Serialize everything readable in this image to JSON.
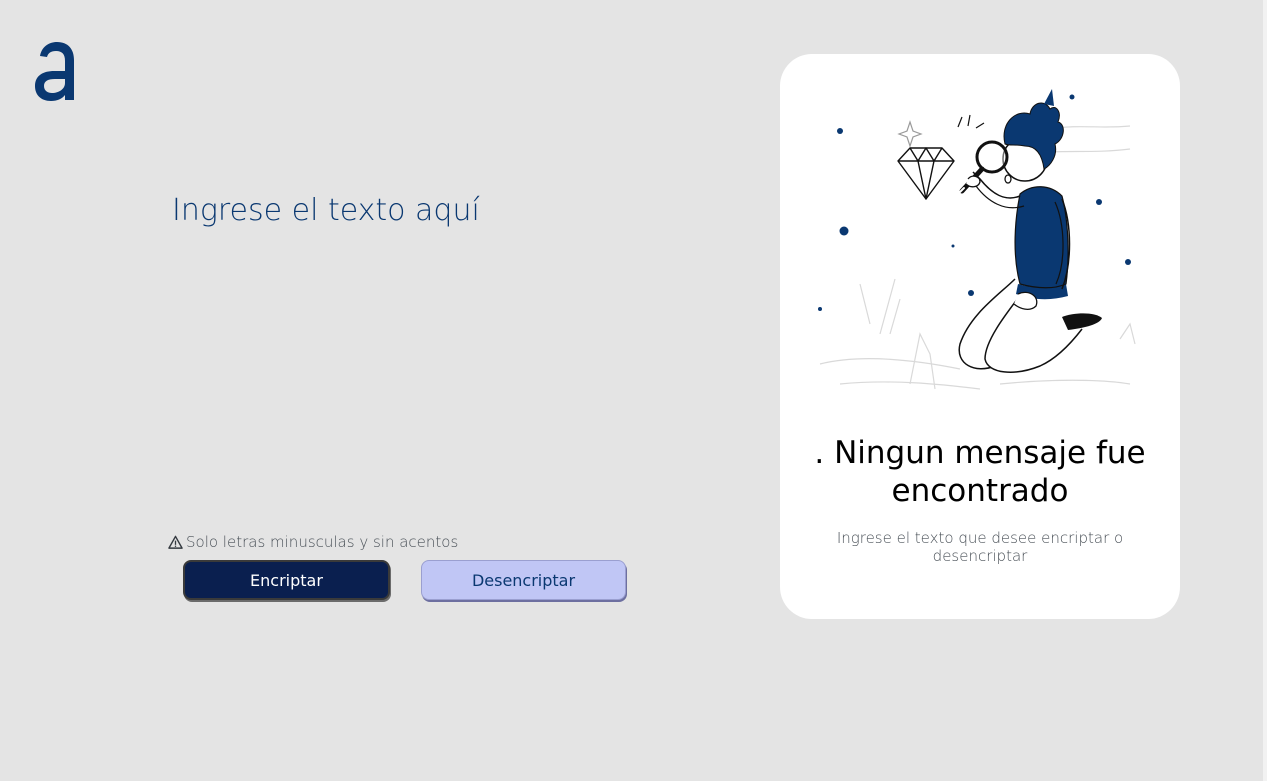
{
  "logo": {
    "icon": "alura-logo-icon",
    "color": "#0a3871"
  },
  "input": {
    "placeholder": "Ingrese el texto aquí",
    "value": ""
  },
  "hint": {
    "icon": "warning-icon",
    "text": "Solo letras minusculas y sin acentos"
  },
  "buttons": {
    "encrypt_label": "Encriptar",
    "decrypt_label": "Desencriptar"
  },
  "output": {
    "illustration": "person-with-magnifier-illustration",
    "title": ". Ningun mensaje fue encontrado",
    "subtitle": "Ingrese el texto que desee encriptar o desencriptar"
  },
  "colors": {
    "background": "#e4e4e4",
    "primary": "#0a3871",
    "encrypt_button": "#0a1f4f",
    "decrypt_button": "#c0c6f5",
    "card": "#ffffff"
  }
}
